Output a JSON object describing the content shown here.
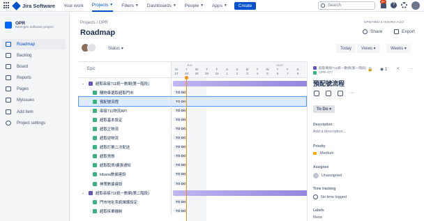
{
  "topnav": {
    "brand": "Jira Software",
    "items": [
      {
        "label": "Your work"
      },
      {
        "label": "Projects"
      },
      {
        "label": "Filters"
      },
      {
        "label": "Dashboards"
      },
      {
        "label": "People"
      },
      {
        "label": "Apps"
      }
    ],
    "create": "Create",
    "search_placeholder": "Search",
    "notification_count": "9+",
    "help": "?"
  },
  "sidebar": {
    "project_name": "OPR",
    "project_type": "Next-gen software project",
    "items": [
      {
        "label": "Roadmap"
      },
      {
        "label": "Backlog"
      },
      {
        "label": "Board"
      },
      {
        "label": "Reports"
      },
      {
        "label": "Pages"
      },
      {
        "label": "Myissues"
      },
      {
        "label": "Add item"
      },
      {
        "label": "Project settings"
      }
    ]
  },
  "header": {
    "breadcrumb": "Projects  /  OPR",
    "title": "Roadmap",
    "updated": "UPDATED 8 HOURS AGO",
    "share": "Share",
    "export": "Export",
    "status": "Status",
    "today": "Today",
    "views": "Views",
    "weeks": "Weeks"
  },
  "timeline": {
    "epic_header": "Epic",
    "months": [
      "JUL",
      "AUG"
    ],
    "day_letters": [
      "M",
      "T",
      "W",
      "T",
      "F",
      "S",
      "S",
      "M",
      "T",
      "W",
      "T",
      "F",
      "S",
      "S"
    ],
    "day_numbers": [
      "27",
      "28",
      "29",
      "30",
      "31",
      "1",
      "2",
      "3",
      "4",
      "5",
      "6",
      "7",
      "8",
      "9"
    ],
    "rows": [
      {
        "label": "超取串接711統一數網(第一階段)",
        "type": "epic",
        "status": ""
      },
      {
        "label": "購物車選取超取門市",
        "type": "story",
        "status": "TO DO"
      },
      {
        "label": "預配號流程",
        "type": "story",
        "status": "TO DO"
      },
      {
        "label": "串接711物流API",
        "type": "story",
        "status": "TO DO"
      },
      {
        "label": "超取基本設定",
        "type": "story",
        "status": "TO DO"
      },
      {
        "label": "超取正物流",
        "type": "story",
        "status": "TO DO"
      },
      {
        "label": "超取逆物流",
        "type": "story",
        "status": "TO DO"
      },
      {
        "label": "超取訂單二次配送",
        "type": "story",
        "status": "TO DO"
      },
      {
        "label": "超取貨態",
        "type": "story",
        "status": "TO DO"
      },
      {
        "label": "超取取貨/擴張通知",
        "type": "story",
        "status": "TO DO"
      },
      {
        "label": "kibana數據建設",
        "type": "story",
        "status": "TO DO"
      },
      {
        "label": "神策數據建設",
        "type": "story",
        "status": "TO DO"
      },
      {
        "label": "超取串接711統一數網(第二階段)",
        "type": "epic",
        "status": ""
      },
      {
        "label": "門市地址系統維護設定",
        "type": "story",
        "status": "TO DO"
      },
      {
        "label": "超取拆單機制",
        "type": "story",
        "status": "TO DO"
      }
    ]
  },
  "panel": {
    "epic": "超取串接711統一數網(第一階段)",
    "key": "OPR-477",
    "watch_count": "1",
    "title": "預配號流程",
    "status": "To Do",
    "description_label": "Description",
    "description_placeholder": "Add a description...",
    "priority_label": "Priority",
    "priority": "Medium",
    "assignee_label": "Assignee",
    "assignee": "Unassigned",
    "time_label": "Time tracking",
    "time": "No time logged",
    "labels_label": "Labels",
    "labels": "None"
  },
  "colors": {
    "accent": "#0052cc",
    "epic": "#6554c0",
    "story": "#36b37e",
    "today": "#ff8b00"
  }
}
